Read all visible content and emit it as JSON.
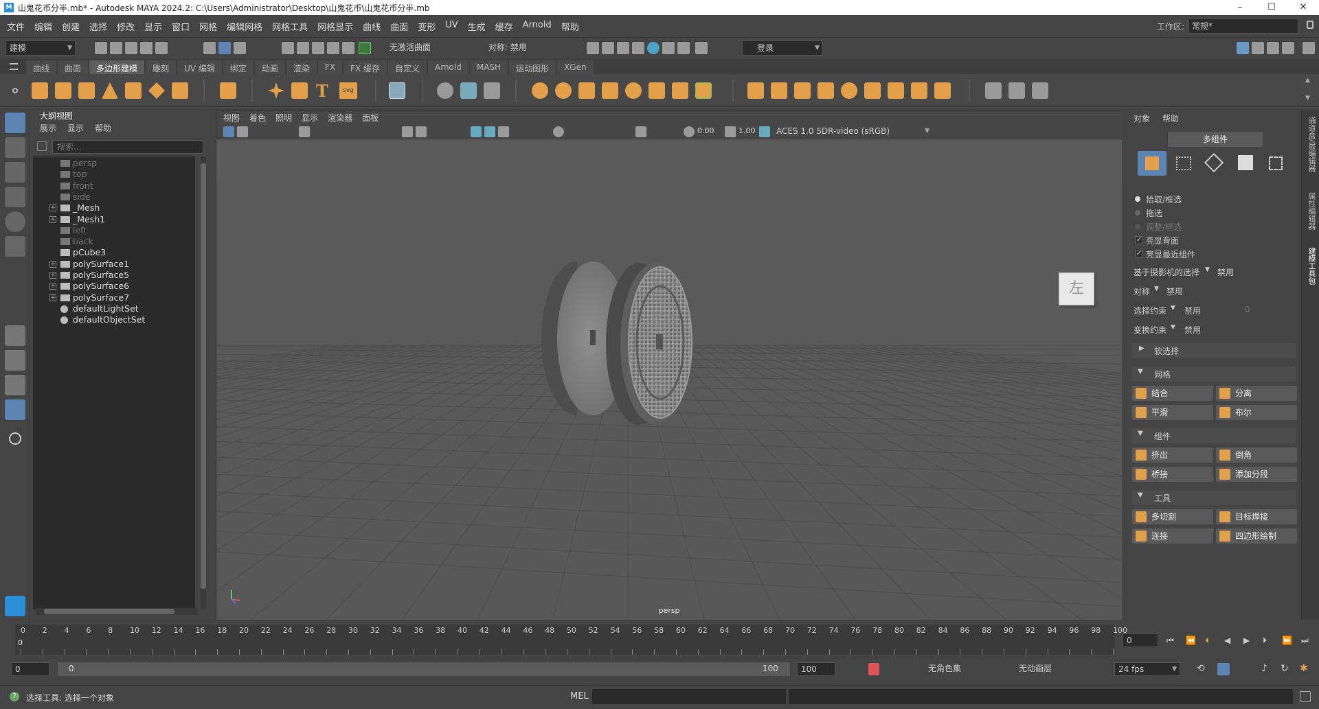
{
  "window": {
    "title": "山鬼花币分半.mb* - Autodesk MAYA 2024.2: C:\\Users\\Administrator\\Desktop\\山鬼花币\\山鬼花币分半.mb",
    "logo": "M",
    "minimize": "–",
    "maximize": "☐",
    "close": "✕"
  },
  "menubar": {
    "items": [
      "文件",
      "编辑",
      "创建",
      "选择",
      "修改",
      "显示",
      "窗口",
      "网格",
      "编辑网格",
      "网格工具",
      "网格显示",
      "曲线",
      "曲面",
      "变形",
      "UV",
      "生成",
      "缓存",
      "Arnold",
      "帮助"
    ],
    "workspace_label": "工作区:",
    "workspace_value": "常规*"
  },
  "statusline": {
    "mode": "建模",
    "live_surface": "无激活曲面",
    "symmetry": "对称: 禁用",
    "login": "登录"
  },
  "shelf": {
    "tabs": [
      "曲线",
      "曲面",
      "多边形建模",
      "雕刻",
      "UV 编辑",
      "绑定",
      "动画",
      "渲染",
      "FX",
      "FX 缓存",
      "自定义",
      "Arnold",
      "MASH",
      "运动图形",
      "XGen"
    ],
    "active_tab": "多边形建模",
    "text_icon": "T",
    "svg_icon": "svg"
  },
  "outliner": {
    "title": "大纲视图",
    "menu": [
      "展示",
      "显示",
      "帮助"
    ],
    "search_placeholder": "搜索...",
    "items": [
      {
        "label": "persp",
        "dim": true,
        "expand": false
      },
      {
        "label": "top",
        "dim": true,
        "expand": false
      },
      {
        "label": "front",
        "dim": true,
        "expand": false
      },
      {
        "label": "side",
        "dim": true,
        "expand": false
      },
      {
        "label": "_Mesh",
        "dim": false,
        "expand": true
      },
      {
        "label": "_Mesh1",
        "dim": false,
        "expand": true
      },
      {
        "label": "left",
        "dim": true,
        "expand": false
      },
      {
        "label": "back",
        "dim": true,
        "expand": false
      },
      {
        "label": "pCube3",
        "dim": false,
        "expand": false
      },
      {
        "label": "polySurface1",
        "dim": false,
        "expand": true
      },
      {
        "label": "polySurface5",
        "dim": false,
        "expand": true
      },
      {
        "label": "polySurface6",
        "dim": false,
        "expand": true
      },
      {
        "label": "polySurface7",
        "dim": false,
        "expand": true
      },
      {
        "label": "defaultLightSet",
        "dim": false,
        "expand": false
      },
      {
        "label": "defaultObjectSet",
        "dim": false,
        "expand": false
      }
    ]
  },
  "viewport": {
    "menu": [
      "视图",
      "着色",
      "照明",
      "显示",
      "渲染器",
      "面板"
    ],
    "exposure": "0.00",
    "gamma": "1.00",
    "colorspace": "ACES 1.0 SDR-video (sRGB)",
    "viewcube": "左",
    "camera": "persp"
  },
  "modeling_toolkit": {
    "menu": [
      "对象",
      "帮助"
    ],
    "multicomponent": "多组件",
    "options": {
      "pick_marquee": "拾取/框选",
      "drag": "拖选",
      "tweak_marquee": "调整/框选",
      "highlight_backfaces": "亮显背面",
      "highlight_nearest": "亮显最近组件"
    },
    "camera_based": "基于摄影机的选择",
    "camera_based_value": "禁用",
    "symmetry": "对称",
    "symmetry_value": "禁用",
    "select_constraint": "选择约束",
    "select_constraint_value": "禁用",
    "select_constraint_num": "0",
    "transform_constraint": "变换约束",
    "transform_constraint_value": "禁用",
    "soft_select": "软选择",
    "sections": {
      "mesh": "网格",
      "components": "组件",
      "tools": "工具"
    },
    "mesh_buttons": [
      "结合",
      "分离",
      "平滑",
      "布尔"
    ],
    "component_buttons": [
      "挤出",
      "倒角",
      "桥接",
      "添加分段"
    ],
    "tool_buttons": [
      "多切割",
      "目标焊接",
      "连接",
      "四边形绘制"
    ]
  },
  "right_strip": [
    "通道盒/层编辑器",
    "属性编辑器",
    "建模工具包"
  ],
  "timeline": {
    "ticks": [
      "0",
      "2",
      "4",
      "6",
      "8",
      "10",
      "12",
      "14",
      "16",
      "18",
      "20",
      "22",
      "24",
      "26",
      "28",
      "30",
      "32",
      "34",
      "36",
      "38",
      "40",
      "42",
      "44",
      "46",
      "48",
      "50",
      "52",
      "54",
      "56",
      "58",
      "60",
      "62",
      "64",
      "66",
      "68",
      "70",
      "72",
      "74",
      "76",
      "78",
      "80",
      "82",
      "84",
      "86",
      "88",
      "90",
      "92",
      "94",
      "96",
      "98",
      "100"
    ],
    "current_frame": "0",
    "current_marker": "0"
  },
  "range": {
    "start": "0",
    "inner_start": "0",
    "inner_end": "100",
    "end": "100",
    "char_set": "无角色集",
    "anim_layer": "无动画层",
    "fps": "24 fps"
  },
  "command": {
    "help": "选择工具: 选择一个对象",
    "lang": "MEL"
  }
}
